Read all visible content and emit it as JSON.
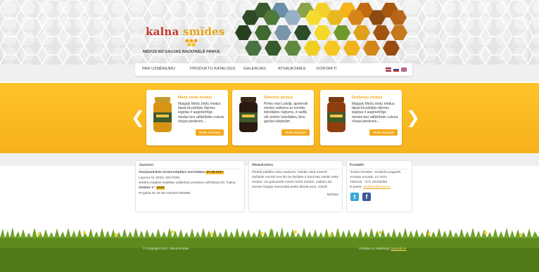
{
  "header": {
    "logo_word1": "kalna",
    "logo_word2": "smīdes",
    "tagline": "MEDUS NO GAUJAS NACIONĀLĀ PARKA"
  },
  "nav": {
    "items": [
      "PAR UZŅĒMUMU",
      "PRODUKTU KATALOGS",
      "GALERIJAS",
      "ATSAUKSMES",
      "KONTAKTI"
    ],
    "flags": [
      "latvian-flag",
      "russian-flag",
      "uk-flag"
    ]
  },
  "slider": {
    "prev": "❮",
    "next": "❯",
    "cards": [
      {
        "title": "Meža ziedu medus",
        "text": [
          "Maigais Meža ziedu medus",
          "tāpat kā pārējās šķirnes",
          "iegūtas ir augstvērtīgs",
          "medus bez atšķirībām cukura",
          "sīrupa piedeves..."
        ],
        "button": "Skatīt katalogā"
      },
      {
        "title": "Sūnrožu medus",
        "text": [
          "Pirmo reizi Latvijā, apvienoti",
          "medus saldumu ar tumšās",
          "šokolādes rūgtumu, it sadlā",
          "vēl redzēs šokolādes.Jūsu",
          "garšas kārpiņām."
        ],
        "button": "Skatīt katalogā"
      },
      {
        "title": "Dzeļveņu medus",
        "text": [
          "Maigais Meža ziedu medus",
          "tāpat kā pārējās šķirnes",
          "iegūtas ir augstvērtīgs",
          "medus bez atšķirībām cukura",
          "sīrupa piedeves..."
        ],
        "button": "Skatīt katalogā"
      }
    ]
  },
  "news": {
    "title": "Jaunumi",
    "line1": "Starptautiskās konkursēpēļas vecinātāņa",
    "date1": "07.09.2017",
    "line2": "Līguma Nr. BIS/L-2017/306.",
    "line3": "sekārtu segkās kvalitātu sašķirbas produktu ražošanai ZS \"Kalna",
    "line4a": "Smīdes 1\"",
    "date2": "2016",
    "line5": "Projekta Nr.15-05-A00403-000088."
  },
  "reviews": {
    "title": "Atsauksmes",
    "line1": "Pilnībā paldību Jūsu saukumi \"Vairāk nekā medus\"",
    "line2": "Dažādie mecīdi mecīšu be beštām ir kaut kas vairāk nekā",
    "line3": "medus. Un patvamāē meirā meirā medus. Laikam pie",
    "line4": "vienas Gaujas Nacionālā parka lāsotā aura. Gardi!",
    "author": "Mašīnja"
  },
  "contacts": {
    "title": "Kontakti",
    "line1": "\"Kalna Smīdes\", Drabešu pagasts,",
    "line2": "Amatas novads, LV-4101",
    "line3": "Tālrunis: +371 26435355",
    "email_label": "E-pasts:",
    "email": "smidites@inbox.lv"
  },
  "footer": {
    "copyright": "© Copyright 2012. Kalna Smīdes",
    "credit_prefix": "Izstrāde un realizācija:",
    "credit_link": "justcode.lv"
  },
  "colors": {
    "accent": "#f4a81c",
    "slider_bg": "#ffc22a",
    "logo_red": "#c0392b",
    "grass": "#5e8a1e"
  }
}
